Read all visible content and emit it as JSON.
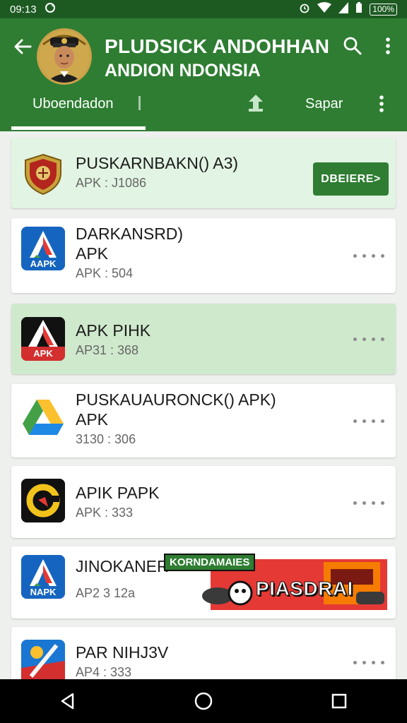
{
  "status": {
    "time": "09:13",
    "battery": "100%"
  },
  "header": {
    "title_line1": "PLUDSICK ANDOHHAN",
    "title_line2": "ANDION NDONSIA"
  },
  "tabs": {
    "active": "Uboendadon",
    "second": "Sapar"
  },
  "apps": [
    {
      "title": "PUSKARNBAKN() A3)",
      "subtitle": "APK : J1086",
      "action": "DBEIERE>"
    },
    {
      "title": "DARKANSRD)",
      "title2": "APK",
      "subtitle": "APK : 504",
      "icon_text": "AAPK"
    },
    {
      "title": "APK PIHK",
      "subtitle": "AP31 : 368",
      "icon_text": "APK"
    },
    {
      "title": "PUSKAUAURONCK() APK)",
      "title2": "APK",
      "subtitle": "3130 : 306"
    },
    {
      "title": "APIK PAPK",
      "subtitle": "APK : 333"
    },
    {
      "title": "JINOKANER",
      "subtitle": "AP2 3 12a",
      "icon_text": "NAPK",
      "banner_tag": "KORNDAMAIES",
      "banner_text": "PIASDRAI"
    },
    {
      "title": "PAR NIHJ3V",
      "subtitle": "AP4 : 333"
    }
  ],
  "colors": {
    "primary": "#2e7d32",
    "status_bar": "#1d5a22",
    "card_highlight": "#cfe9cc",
    "card_highlight_light": "#e2f4e3"
  },
  "icons": [
    "back-arrow-icon",
    "search-icon",
    "more-vert-icon",
    "upload-icon",
    "nav-back-icon",
    "nav-home-icon",
    "nav-recents-icon"
  ]
}
